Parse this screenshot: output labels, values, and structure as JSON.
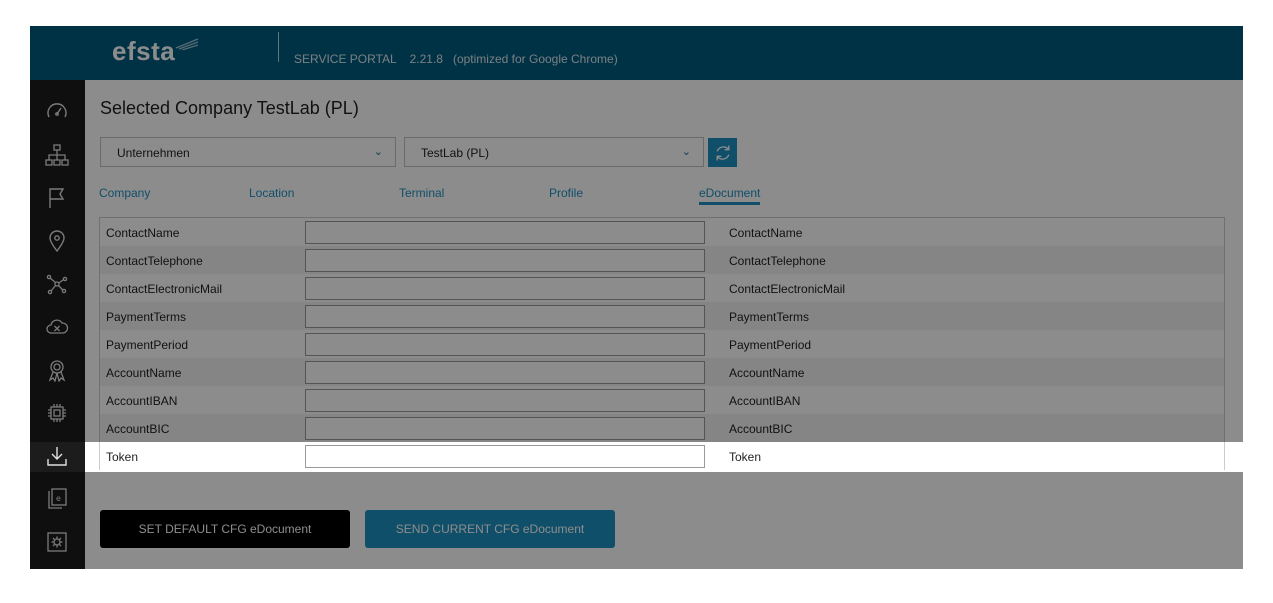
{
  "header": {
    "logo_text": "efsta",
    "portal_info": "SERVICE PORTAL    2.21.8   (optimized for Google Chrome)"
  },
  "sidebar": {
    "icons": [
      "dashboard-icon",
      "hierarchy-icon",
      "flag-icon",
      "location-pin-icon",
      "network-icon",
      "cloud-x-icon",
      "certificate-icon",
      "chip-icon",
      "download-icon",
      "document-e-icon",
      "settings-box-icon"
    ]
  },
  "main": {
    "title": "Selected Company TestLab (PL)",
    "type_select": {
      "value": "Unternehmen"
    },
    "company_select": {
      "value": "TestLab (PL)"
    },
    "tabs": [
      {
        "label": "Company"
      },
      {
        "label": "Location"
      },
      {
        "label": "Terminal"
      },
      {
        "label": "Profile"
      },
      {
        "label": "eDocument",
        "active": true
      }
    ],
    "rows": [
      {
        "label": "ContactName",
        "value": "",
        "right_label": "ContactName"
      },
      {
        "label": "ContactTelephone",
        "value": "",
        "right_label": "ContactTelephone"
      },
      {
        "label": "ContactElectronicMail",
        "value": "",
        "right_label": "ContactElectronicMail"
      },
      {
        "label": "PaymentTerms",
        "value": "",
        "right_label": "PaymentTerms"
      },
      {
        "label": "PaymentPeriod",
        "value": "",
        "right_label": "PaymentPeriod"
      },
      {
        "label": "AccountName",
        "value": "",
        "right_label": "AccountName"
      },
      {
        "label": "AccountIBAN",
        "value": "",
        "right_label": "AccountIBAN"
      },
      {
        "label": "AccountBIC",
        "value": "",
        "right_label": "AccountBIC"
      },
      {
        "label": "Token",
        "value": "",
        "right_label": "Token"
      }
    ],
    "buttons": {
      "set_default": "SET DEFAULT CFG eDocument",
      "send_current": "SEND CURRENT CFG eDocument"
    }
  },
  "colors": {
    "header_bg": "#005b7f",
    "accent": "#1e90c2",
    "sidebar_bg": "#1c1c1c"
  }
}
